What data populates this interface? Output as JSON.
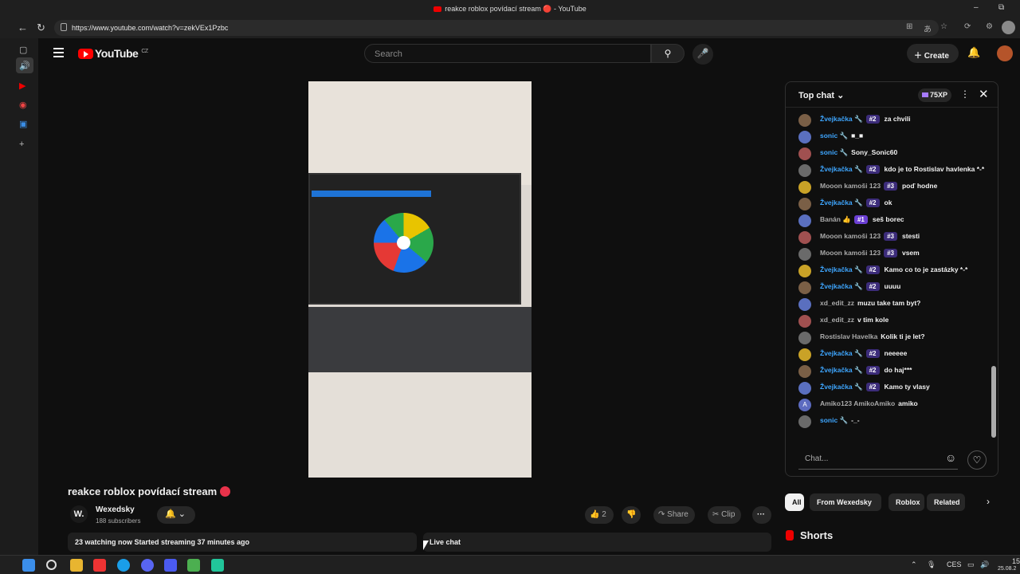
{
  "window": {
    "title": "reakce roblox povídací stream 🔴 - YouTube",
    "minimize": "–",
    "restore": "⧉"
  },
  "browser": {
    "url": "https://www.youtube.com/watch?v=zekVEx1Pzbc",
    "back": "←",
    "reload": "↻",
    "icons": [
      "⊞",
      "あ",
      "☆",
      "⟳",
      "⚙"
    ]
  },
  "youtube": {
    "logo": "YouTube",
    "region": "CZ",
    "search_placeholder": "Search",
    "create_label": "Create"
  },
  "video": {
    "title": "reakce roblox povídací stream",
    "channel_initial": "W.",
    "channel_name": "Wexedsky",
    "subscribers": "188 subscribers",
    "like_count": "2",
    "share_label": "Share",
    "clip_label": "Clip",
    "description": "23 watching now  Started streaming 37 minutes ago",
    "live_chat_label": "Live chat"
  },
  "chat": {
    "header": "Top chat",
    "xp": "75XP",
    "input_placeholder": "Chat...",
    "messages": [
      {
        "author": "Žvejkačka 🔧",
        "rank": "#2",
        "text": "za chvili",
        "avatar": "img"
      },
      {
        "author": "sonic 🔧",
        "rank": "",
        "text": "■_■",
        "avatar": "img"
      },
      {
        "author": "sonic 🔧",
        "rank": "",
        "text": "Sony_Sonic60",
        "avatar": "img"
      },
      {
        "author": "Žvejkačka 🔧",
        "rank": "#2",
        "text": "kdo je to Rostislav havlenka *-*",
        "avatar": "img"
      },
      {
        "author": "Mooon kamoši 123",
        "rank": "#3",
        "text": "poď hodne",
        "avatar": "img"
      },
      {
        "author": "Žvejkačka 🔧",
        "rank": "#2",
        "text": "ok",
        "avatar": "img"
      },
      {
        "author": "Banán 👍",
        "rank": "#1",
        "text": "seš borec",
        "avatar": "img"
      },
      {
        "author": "Mooon kamoši 123",
        "rank": "#3",
        "text": "stesti",
        "avatar": "img"
      },
      {
        "author": "Mooon kamoši 123",
        "rank": "#3",
        "text": "vsem",
        "avatar": "img"
      },
      {
        "author": "Žvejkačka 🔧",
        "rank": "#2",
        "text": "Kamo co to je zastázky *-*",
        "avatar": "img"
      },
      {
        "author": "Žvejkačka 🔧",
        "rank": "#2",
        "text": "uuuu",
        "avatar": "img"
      },
      {
        "author": "xd_edit_zz",
        "rank": "",
        "text": "muzu take tam byt?",
        "avatar": "img"
      },
      {
        "author": "xd_edit_zz",
        "rank": "",
        "text": "v tim kole",
        "avatar": "img"
      },
      {
        "author": "Rostislav Havelka",
        "rank": "",
        "text": "Kolik ti je let?",
        "avatar": "img"
      },
      {
        "author": "Žvejkačka 🔧",
        "rank": "#2",
        "text": "neeeee",
        "avatar": "img"
      },
      {
        "author": "Žvejkačka 🔧",
        "rank": "#2",
        "text": "do haj***",
        "avatar": "img"
      },
      {
        "author": "Žvejkačka 🔧",
        "rank": "#2",
        "text": "Kamo ty vlasy",
        "avatar": "img"
      },
      {
        "author": "Amiko123 AmikoAmiko",
        "rank": "",
        "text": "amiko",
        "avatar": "A"
      },
      {
        "author": "sonic 🔧",
        "rank": "",
        "text": "-_-",
        "avatar": "img"
      }
    ]
  },
  "chips": [
    "All",
    "From Wexedsky",
    "Roblox",
    "Related"
  ],
  "shorts_label": "Shorts",
  "taskbar": {
    "lang": "CES",
    "time": "15",
    "date": "25.08.2"
  }
}
